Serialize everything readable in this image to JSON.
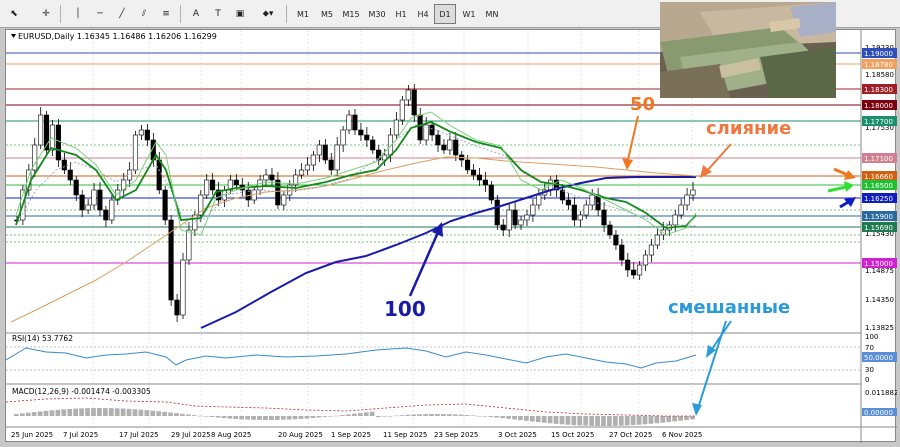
{
  "toolbar": {
    "timeframes": [
      "M1",
      "M5",
      "M15",
      "M30",
      "H1",
      "H4",
      "D1",
      "W1",
      "MN"
    ],
    "active_timeframe": "D1"
  },
  "chart": {
    "header": "EURUSD,Daily  1.16345 1.16486 1.16206 1.16299",
    "annotations": {
      "ma50": "50",
      "ma100": "100",
      "merge": "слияние",
      "mixed": "смешанные"
    },
    "price_scale": [
      "1.19230",
      "1.18580",
      "1.17530",
      "1.16480",
      "1.15430",
      "1.14875",
      "1.14350",
      "1.13825"
    ],
    "levels": [
      {
        "label": "1.19000",
        "color": "#2e4fb8"
      },
      {
        "label": "1.18780",
        "color": "#f2a060"
      },
      {
        "label": "1.18300",
        "color": "#a0202a"
      },
      {
        "label": "1.18000",
        "color": "#7a0010"
      },
      {
        "label": "1.17700",
        "color": "#1a8f6a"
      },
      {
        "label": "1.17100",
        "color": "#d08090"
      },
      {
        "label": "1.16660",
        "color": "#d06010"
      },
      {
        "label": "1.16500",
        "color": "#20c030"
      },
      {
        "label": "1.16250",
        "color": "#1020c0"
      },
      {
        "label": "1.15900",
        "color": "#2a6aa0"
      },
      {
        "label": "1.15690",
        "color": "#207a50"
      },
      {
        "label": "1.15000",
        "color": "#d020d0"
      }
    ],
    "dates": [
      "25 Jun 2025",
      "7 Jul 2025",
      "17 Jul 2025",
      "29 Jul 2025",
      "8 Aug 2025",
      "20 Aug 2025",
      "1 Sep 2025",
      "11 Sep 2025",
      "23 Sep 2025",
      "3 Oct 2025",
      "15 Oct 2025",
      "27 Oct 2025",
      "6 Nov 2025"
    ]
  },
  "rsi": {
    "header": "RSI(14) 53.7762",
    "scale": [
      "100",
      "70",
      "30",
      "0"
    ],
    "value_label": "50.0000"
  },
  "macd": {
    "header": "MACD(12,26,9) -0.001474 -0.003305",
    "scale": [
      "0.011882",
      "0.00000"
    ]
  }
}
